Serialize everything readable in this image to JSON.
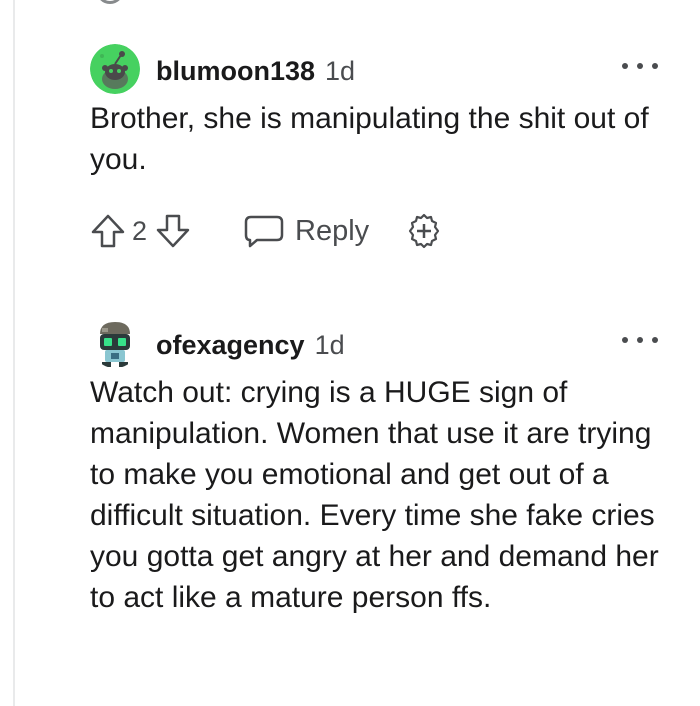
{
  "comments": [
    {
      "username": "blumoon138",
      "time": "1d",
      "body": "Brother, she is manipulating the shit out of you.",
      "votes": "2",
      "reply_label": "Reply",
      "avatar_color": "#46d160"
    },
    {
      "username": "ofexagency",
      "time": "1d",
      "body": "Watch out: crying is a HUGE sign of manipulation. Women that use it are trying to make you emotional and get out of a difficult situation. Every time she fake cries you gotta get angry at her and demand her to act like a mature person ffs."
    }
  ],
  "icons": {
    "more": "more-options-icon",
    "upvote": "upvote-arrow-icon",
    "downvote": "downvote-arrow-icon",
    "reply": "speech-bubble-icon",
    "award": "add-award-icon"
  },
  "colors": {
    "text": "#1a1a1b",
    "meta": "#4a4c4f",
    "thread_line": "#e9eaeb"
  }
}
